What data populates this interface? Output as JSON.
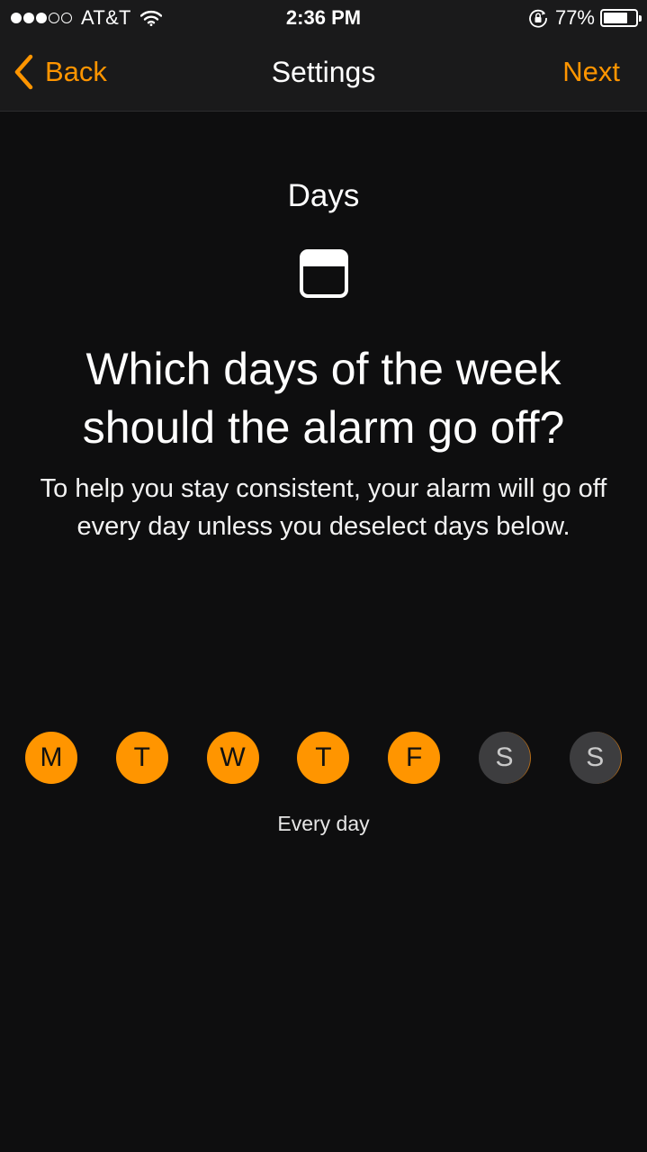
{
  "status_bar": {
    "signal_filled": 3,
    "signal_total": 5,
    "carrier": "AT&T",
    "time": "2:36 PM",
    "battery_text": "77%",
    "battery_level": 0.77
  },
  "nav": {
    "back_label": "Back",
    "title": "Settings",
    "next_label": "Next"
  },
  "content": {
    "section_title": "Days",
    "headline_line1": "Which days of the week",
    "headline_line2": "should the alarm go off?",
    "subtext": "To help you stay consistent, your alarm will go off every day unless you deselect days below."
  },
  "days": [
    {
      "letter": "M",
      "selected": true
    },
    {
      "letter": "T",
      "selected": true
    },
    {
      "letter": "W",
      "selected": true
    },
    {
      "letter": "T",
      "selected": true
    },
    {
      "letter": "F",
      "selected": true
    },
    {
      "letter": "S",
      "selected": false
    },
    {
      "letter": "S",
      "selected": false
    }
  ],
  "summary": "Every day",
  "colors": {
    "accent": "#ff9500",
    "background": "#0e0e0f",
    "nav_background": "#1a1a1b",
    "day_off": "#3d3d3f"
  }
}
